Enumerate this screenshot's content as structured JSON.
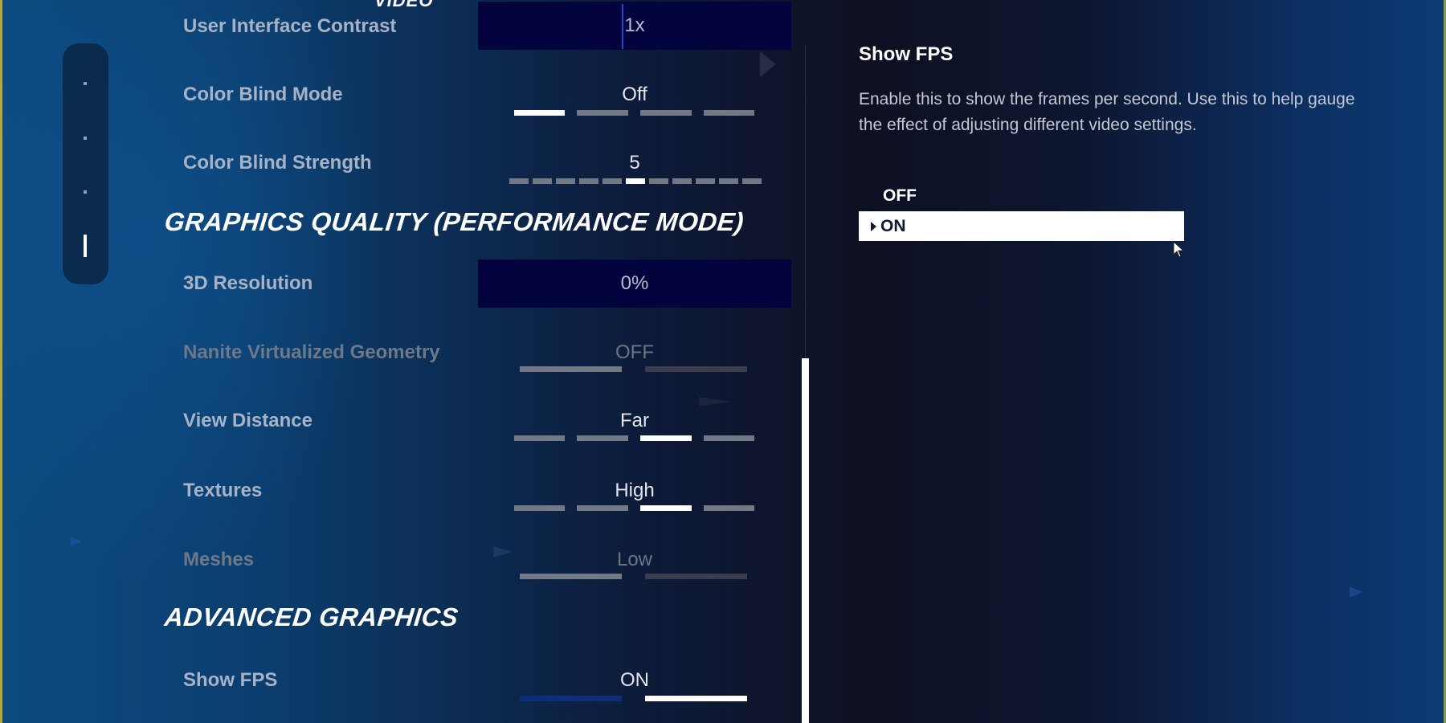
{
  "page_section_heading": "VIDEO",
  "side_nav": {
    "items": [
      "tab-1",
      "tab-2",
      "tab-3",
      "tab-4"
    ],
    "active_index": 3
  },
  "settings": {
    "ui_contrast": {
      "label": "User Interface Contrast",
      "value": "1x"
    },
    "color_blind_mode": {
      "label": "Color Blind Mode",
      "value": "Off",
      "options_count": 4,
      "selected_index": 0
    },
    "color_blind_strength": {
      "label": "Color Blind Strength",
      "value": "5",
      "min": 0,
      "max": 10
    },
    "graphics_section": "GRAPHICS QUALITY (PERFORMANCE MODE)",
    "resolution_3d": {
      "label": "3D Resolution",
      "value": "0%"
    },
    "nanite": {
      "label": "Nanite Virtualized Geometry",
      "value": "OFF",
      "disabled": true
    },
    "view_distance": {
      "label": "View Distance",
      "value": "Far",
      "options_count": 4,
      "selected_index": 2
    },
    "textures": {
      "label": "Textures",
      "value": "High",
      "options_count": 4,
      "selected_index": 2
    },
    "meshes": {
      "label": "Meshes",
      "value": "Low",
      "disabled": true
    },
    "advanced_section": "ADVANCED GRAPHICS",
    "show_fps": {
      "label": "Show FPS",
      "value": "ON",
      "selected_index": 1
    }
  },
  "detail_panel": {
    "title": "Show FPS",
    "description": "Enable this to show the frames per second. Use this to help gauge the effect of adjusting different video settings.",
    "options": [
      "OFF",
      "ON"
    ],
    "selected": "ON"
  },
  "colors": {
    "accent_blue": "#0e2e7a",
    "value_box": "#03033d",
    "selected_white": "#ffffff"
  }
}
